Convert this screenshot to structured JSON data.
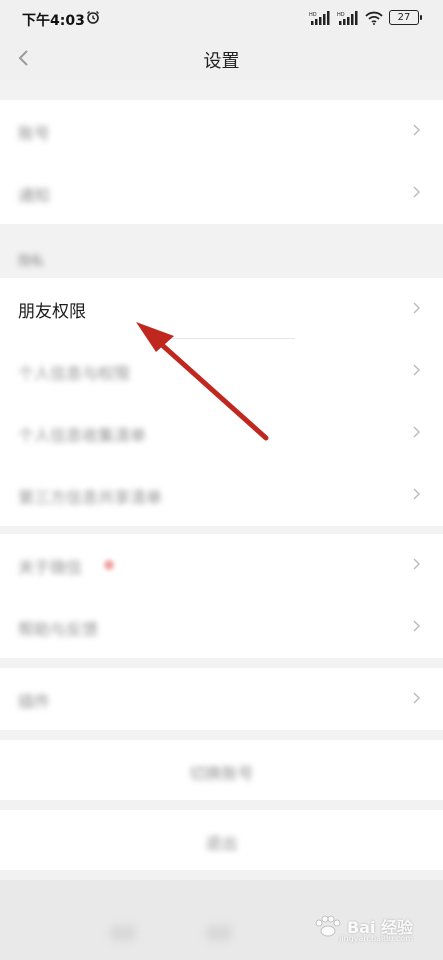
{
  "status_bar": {
    "time": "下午4:03",
    "battery": "27",
    "signal1": "HD",
    "signal2": "HD"
  },
  "header": {
    "title": "设置"
  },
  "items": {
    "section1": [
      "账号",
      "通知"
    ],
    "group_label": "隐私",
    "highlighted": "朋友权限",
    "section2": [
      "个人信息与权限",
      "个人信息收集清单",
      "第三方信息共享清单"
    ],
    "section3": [
      "关于微信",
      "帮助与反馈"
    ],
    "section4": [
      "插件"
    ]
  },
  "buttons": {
    "switch_account": "切换账号",
    "logout": "退出"
  },
  "watermark": {
    "text": "Bai 经验",
    "sub": "jingyan.baidu.com"
  },
  "colors": {
    "arrow": "#c0281f",
    "background": "#f2f2f2"
  }
}
